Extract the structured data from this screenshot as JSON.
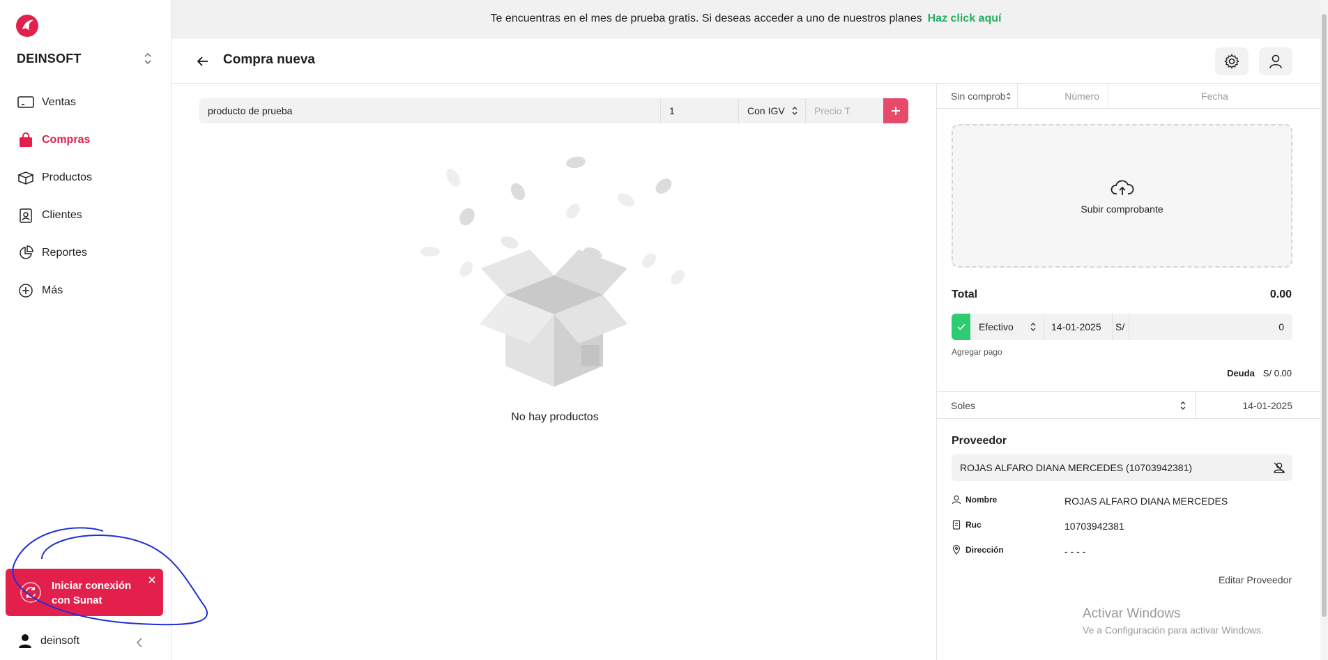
{
  "banner": {
    "message": "Te encuentras en el mes de prueba gratis. Si deseas acceder a uno de nuestros planes",
    "link": "Haz click aquí"
  },
  "sidebar": {
    "brand": "DEINSOFT",
    "items": [
      {
        "label": "Ventas",
        "icon": "monitor-icon",
        "active": false
      },
      {
        "label": "Compras",
        "icon": "shopping-bag-icon",
        "active": true
      },
      {
        "label": "Productos",
        "icon": "box-icon",
        "active": false
      },
      {
        "label": "Clientes",
        "icon": "id-badge-icon",
        "active": false
      },
      {
        "label": "Reportes",
        "icon": "pie-chart-icon",
        "active": false
      },
      {
        "label": "Más",
        "icon": "plus-circle-icon",
        "active": false
      }
    ],
    "toast": {
      "text": "Iniciar conexión con Sunat"
    },
    "user": {
      "name": "deinsoft"
    }
  },
  "header": {
    "title": "Compra nueva"
  },
  "add_product": {
    "product": "producto de prueba",
    "quantity": "1",
    "tax_option": "Con IGV",
    "price_placeholder": "Precio T."
  },
  "empty_state": {
    "text": "No hay productos"
  },
  "document": {
    "type": "Sin comprobante",
    "number_placeholder": "Número",
    "date_placeholder": "Fecha"
  },
  "upload": {
    "label": "Subir comprobante"
  },
  "totals": {
    "label": "Total",
    "value": "0.00"
  },
  "payment": {
    "method": "Efectivo",
    "date": "14-01-2025",
    "currency_symbol": "S/",
    "amount": "0",
    "add_label": "Agregar pago",
    "debt_label": "Deuda",
    "debt_value": "S/ 0.00"
  },
  "currency": {
    "name": "Soles",
    "date": "14-01-2025"
  },
  "provider": {
    "title": "Proveedor",
    "selected": "ROJAS ALFARO DIANA MERCEDES (10703942381)",
    "fields": [
      {
        "label": "Nombre",
        "value": "ROJAS ALFARO DIANA MERCEDES"
      },
      {
        "label": "Ruc",
        "value": "10703942381"
      },
      {
        "label": "Dirección",
        "value": "- - - -"
      }
    ],
    "edit_label": "Editar Proveedor"
  },
  "watermark": {
    "line1": "Activar Windows",
    "line2": "Ve a Configuración para activar Windows."
  },
  "colors": {
    "accent": "#e3204b",
    "success": "#2ecc71",
    "link": "#27ae60"
  }
}
